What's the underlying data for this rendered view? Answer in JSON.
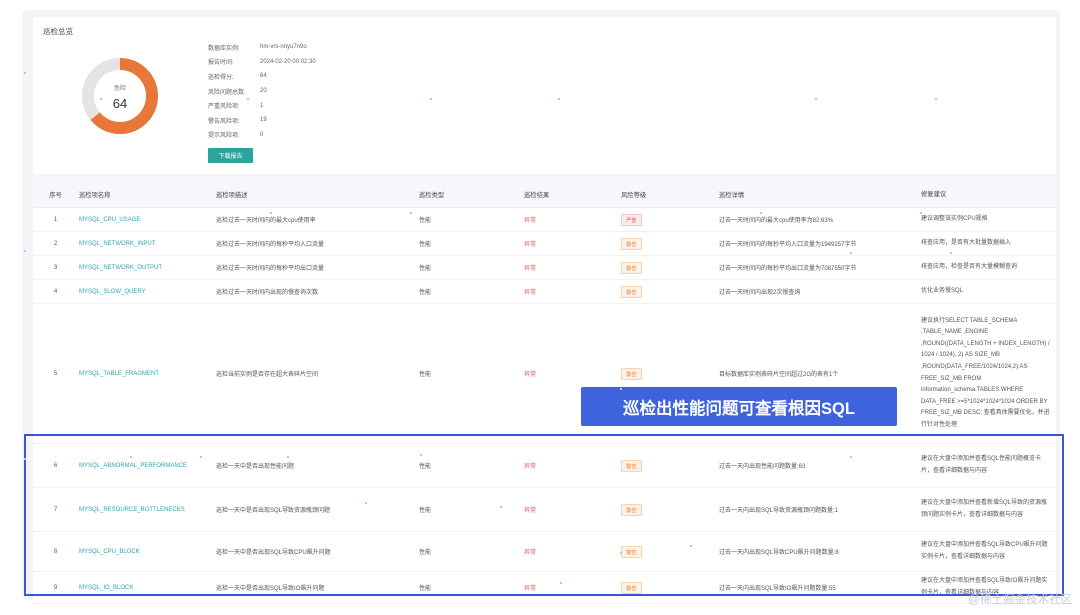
{
  "summary": {
    "title": "巡检总览",
    "donut_label": "危险",
    "donut_score": "64",
    "score_fraction": 0.64,
    "colors": {
      "score": "#e8773a",
      "track": "#e4e4e4"
    },
    "info": [
      {
        "key": "数据库实例:",
        "value": "hm-vrs-nnyu7n9o"
      },
      {
        "key": "报告时间:",
        "value": "2024-02-20 00:02:30"
      },
      {
        "key": "巡检得分:",
        "value": "64"
      },
      {
        "key": "风险问题总数:",
        "value": "20"
      },
      {
        "key": "严重风险项:",
        "value": "1"
      },
      {
        "key": "警告风险项:",
        "value": "19"
      },
      {
        "key": "提示风险项:",
        "value": "0"
      }
    ],
    "download_label": "下载报告"
  },
  "table": {
    "headers": [
      "序号",
      "巡检项名称",
      "巡检项描述",
      "巡检类型",
      "巡检结果",
      "风险等级",
      "巡检详情",
      "修复建议"
    ],
    "rows": [
      {
        "idx": "1",
        "name": "MYSQL_CPU_USAGE",
        "desc": "巡检过去一天时间内的最大cpu使用率",
        "type": "性能",
        "result": "异常",
        "level": "严重",
        "level_kind": "serious",
        "detail": "过去一天时间内的最大cpu使用率为82.63%",
        "advice": "建议调整该实例CPU规格"
      },
      {
        "idx": "2",
        "name": "MYSQL_NETWORK_INPUT",
        "desc": "巡检过去一天时间内的每秒平均入口流量",
        "type": "性能",
        "result": "异常",
        "level": "警告",
        "level_kind": "warn",
        "detail": "过去一天时间内的每秒平均入口流量为1949257字节",
        "advice": "排查应用，是否有大批量数据插入"
      },
      {
        "idx": "3",
        "name": "MYSQL_NETWORK_OUTPUT",
        "desc": "巡检过去一天时间内的每秒平均出口流量",
        "type": "性能",
        "result": "异常",
        "level": "警告",
        "level_kind": "warn",
        "detail": "过去一天时间内的每秒平均出口流量为7087550字节",
        "advice": "排查应用，检查是否有大量模糊查询"
      },
      {
        "idx": "4",
        "name": "MYSQL_SLOW_QUERY",
        "desc": "巡检过去一天时间内出现的慢查询次数",
        "type": "性能",
        "result": "异常",
        "level": "警告",
        "level_kind": "warn",
        "detail": "过去一天时间内出现2次慢查询",
        "advice": "优化业务慢SQL"
      },
      {
        "idx": "5",
        "name": "MYSQL_TABLE_FRAGMENT",
        "desc": "巡检当前实例是否存在超大表碎片空间",
        "type": "性能",
        "result": "异常",
        "level": "警告",
        "level_kind": "warn",
        "detail": "目标数据库实例表碎片空间超过2G的表有1个",
        "advice": "建议执行SELECT TABLE_SCHEMA ,TABLE_NAME ,ENGINE ,ROUND((DATA_LENGTH + INDEX_LENGTH) / 1024 / 1024), 2) AS SIZE_MB ,ROUND(DATA_FREE/1024/1024,2) AS FREE_SIZ_MB FROM information_schema.TABLES WHERE DATA_FREE >=5*1024*1024*1024 ORDER BY FREE_SIZ_MB DESC; 查看具体需要优化，并进行针对性处理"
      },
      {
        "idx": "6",
        "name": "MYSQL_ABNORMAL_PERFORMANCE",
        "desc": "巡检一天中是否出现性能问题",
        "type": "性能",
        "result": "异常",
        "level": "警告",
        "level_kind": "warn",
        "detail": "过去一天内出现性能问题数量:63",
        "advice": "建议在大盘中添加并查看SQL性能问题概览卡片，查看详细数据与内容"
      },
      {
        "idx": "7",
        "name": "MYSQL_RESOURCE_BOTTLENECKS",
        "desc": "巡检一天中是否出现SQL导致资源瓶颈问题",
        "type": "性能",
        "result": "异常",
        "level": "警告",
        "level_kind": "warn",
        "detail": "过去一天内出现SQL导致资源瓶颈问题数量:1",
        "advice": "建议在大盘中添加并查看新增SQL导致的资源瓶颈问题实例卡片，查看详细数据与内容"
      },
      {
        "idx": "8",
        "name": "MYSQL_CPU_BLOCK",
        "desc": "巡检一天中是否出现SQL导致CPU飙升问题",
        "type": "性能",
        "result": "异常",
        "level": "警告",
        "level_kind": "warn",
        "detail": "过去一天内出现SQL导致CPU飙升问题数量:8",
        "advice": "建议在大盘中添加并查看SQL导致CPU飙升问题实例卡片，查看详细数据与内容"
      },
      {
        "idx": "9",
        "name": "MYSQL_IO_BLOCK",
        "desc": "巡检一天中是否出现SQL导致IO飙升问题",
        "type": "性能",
        "result": "异常",
        "level": "警告",
        "level_kind": "warn",
        "detail": "过去一天内出现SQL导致IO飙升问题数量:55",
        "advice": "建议在大盘中添加并查看SQL导致IO飙升问题实例卡片，查看详细数据与内容"
      }
    ]
  },
  "callout": "巡检出性能问题可查看根因SQL",
  "watermark": "@稀土掘金技术社区",
  "colors": {
    "link": "#34a3aa",
    "abnormal": "#e05a5a",
    "warn": "#e8843e",
    "button": "#2aa59c",
    "callout": "#3e63dd",
    "highlight": "#3a55d6"
  }
}
